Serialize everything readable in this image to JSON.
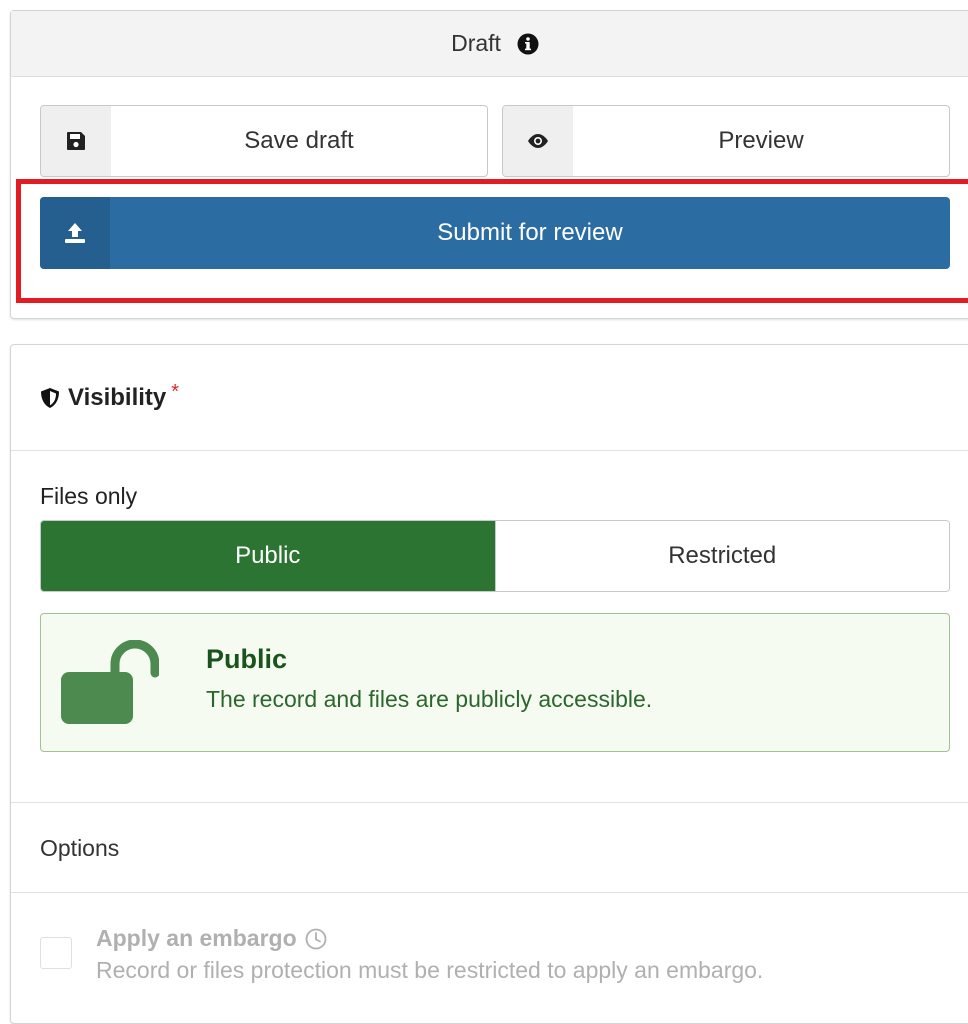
{
  "draft": {
    "status_label": "Draft",
    "save_label": "Save draft",
    "preview_label": "Preview",
    "submit_label": "Submit for review"
  },
  "visibility": {
    "title": "Visibility",
    "required_mark": "*",
    "files_label": "Files only",
    "options": [
      "Public",
      "Restricted"
    ],
    "selected": "Public",
    "message_title": "Public",
    "message_text": "The record and files are publicly accessible.",
    "options_section_label": "Options",
    "embargo_label": "Apply an embargo",
    "embargo_help": "Record or files protection must be restricted to apply an embargo."
  },
  "colors": {
    "primary": "#2b6ca3",
    "public_green": "#2b7431",
    "highlight": "#e31b23"
  },
  "icons": [
    "info-icon",
    "save-icon",
    "eye-icon",
    "upload-icon",
    "shield-icon",
    "unlock-icon",
    "clock-icon"
  ]
}
